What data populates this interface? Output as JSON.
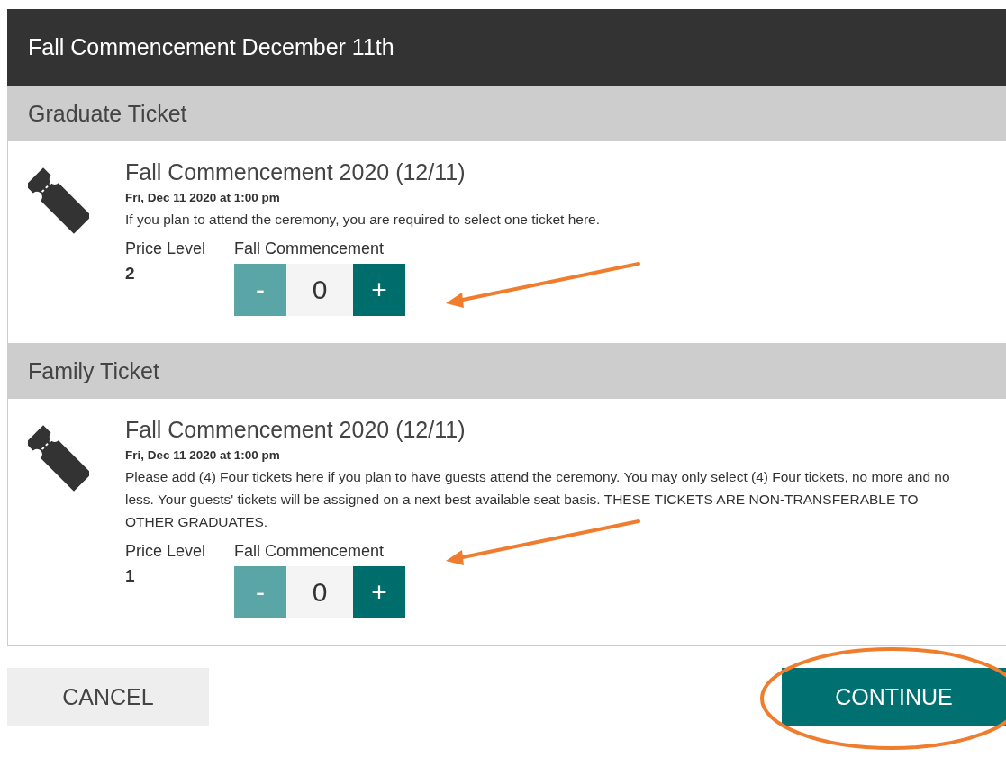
{
  "header": {
    "title": "Fall Commencement December 11th"
  },
  "sections": [
    {
      "heading": "Graduate Ticket",
      "event_title": "Fall Commencement 2020 (12/11)",
      "date": "Fri, Dec 11 2020 at 1:00 pm",
      "description": "If you plan to attend the ceremony, you are required to select one ticket here.",
      "price_label": "Price Level",
      "price_level": "2",
      "quantity_label": "Fall Commencement",
      "minus": "-",
      "quantity": "0",
      "plus": "+"
    },
    {
      "heading": "Family Ticket",
      "event_title": "Fall Commencement 2020 (12/11)",
      "date": "Fri, Dec 11 2020 at 1:00 pm",
      "description": "Please add (4) Four tickets here if you plan to have guests attend the ceremony. You may only select (4) Four tickets, no more and no less. Your guests' tickets will be assigned on a next best available seat basis. THESE TICKETS ARE NON-TRANSFERABLE TO OTHER GRADUATES.",
      "price_label": "Price Level",
      "price_level": "1",
      "quantity_label": "Fall Commencement",
      "minus": "-",
      "quantity": "0",
      "plus": "+"
    }
  ],
  "buttons": [
    {
      "label": "CANCEL",
      "kind": "secondary"
    },
    {
      "label": "CONTINUE",
      "kind": "primary"
    }
  ]
}
